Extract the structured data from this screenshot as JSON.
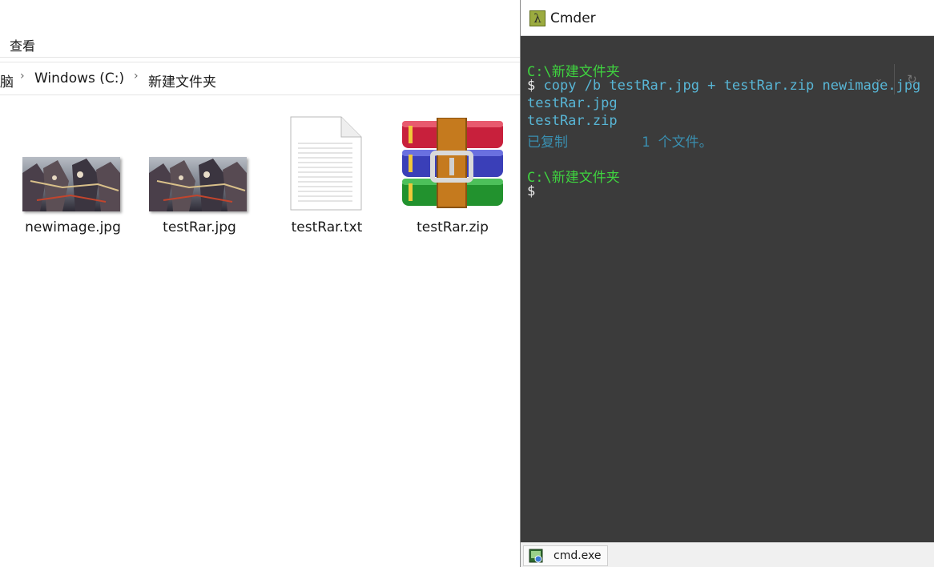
{
  "explorer": {
    "ribbon": {
      "view_tab": "查看"
    },
    "address": {
      "partial_crumb": "脑",
      "drive_crumb": "Windows  (C:)",
      "folder_crumb": "新建文件夹",
      "separator": "›"
    },
    "files": [
      {
        "name": "newimage.jpg",
        "icon": "image-thumbnail"
      },
      {
        "name": "testRar.jpg",
        "icon": "image-thumbnail"
      },
      {
        "name": "testRar.txt",
        "icon": "text-document-icon"
      },
      {
        "name": "testRar.zip",
        "icon": "winrar-archive-icon"
      }
    ]
  },
  "cmder": {
    "title": "Cmder",
    "logo_glyph": "λ",
    "terminal_lines": [
      {
        "text": "C:\\新建文件夹",
        "style": "green"
      },
      {
        "prompt": "$",
        "text": " copy /b testRar.jpg + testRar.zip newimage.jpg",
        "style": "cyan"
      },
      {
        "text": "testRar.jpg",
        "style": "cyan"
      },
      {
        "text": "testRar.zip",
        "style": "cyan"
      },
      {
        "text": "已复制         1 个文件。",
        "style": "muted"
      },
      {
        "text": "",
        "style": "blank"
      },
      {
        "text": "C:\\新建文件夹",
        "style": "green"
      },
      {
        "prompt": "$",
        "text": "",
        "style": "white"
      }
    ],
    "tab_label": "cmd.exe",
    "colors": {
      "background": "#3b3b3b",
      "path": "#3fd33f",
      "output": "#58b6d6",
      "status": "#3a8fb0",
      "prompt": "#eeeeee"
    }
  }
}
